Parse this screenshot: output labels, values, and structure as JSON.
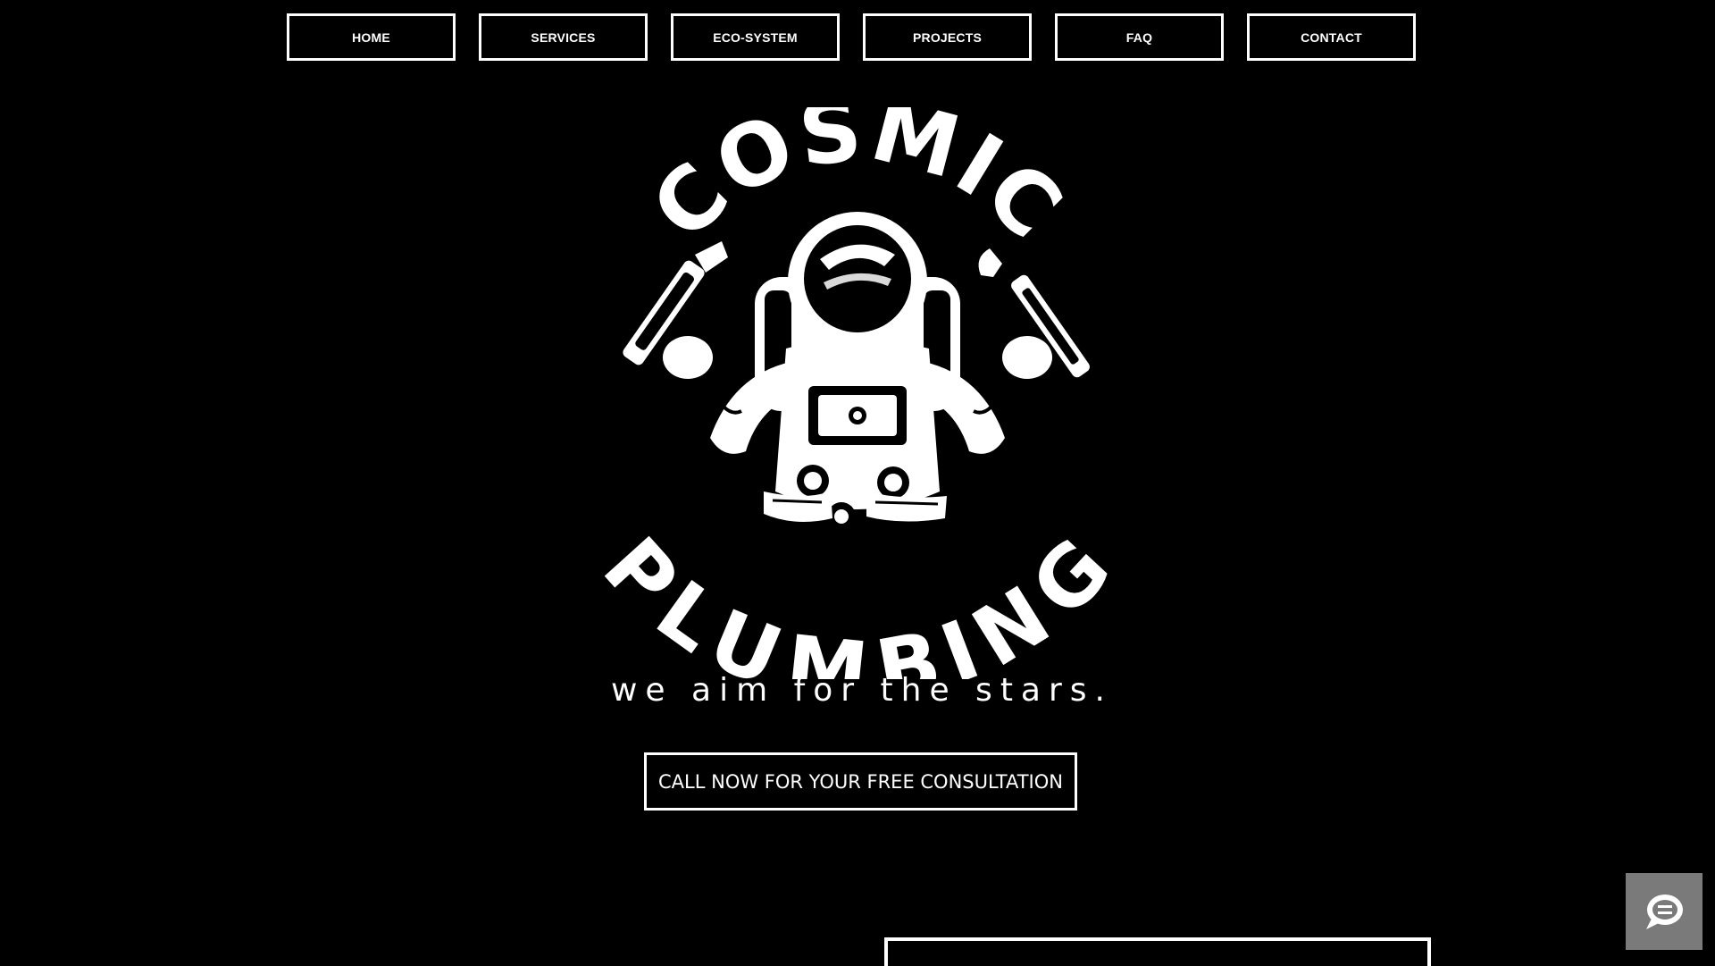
{
  "nav": {
    "items": [
      {
        "label": "HOME"
      },
      {
        "label": "SERVICES"
      },
      {
        "label": "ECO-SYSTEM"
      },
      {
        "label": "PROJECTS"
      },
      {
        "label": "FAQ"
      },
      {
        "label": "CONTACT"
      }
    ]
  },
  "logo": {
    "top_word": "COSMIC",
    "bottom_word": "PLUMBING",
    "icon": "astronaut-plumber-icon"
  },
  "tagline": "we aim for the stars.",
  "cta": {
    "label": "CALL NOW FOR YOUR FREE CONSULTATION"
  },
  "chat_widget": {
    "icon": "chat-bubble-icon"
  },
  "colors": {
    "background": "#000000",
    "foreground": "#ffffff",
    "chat_bg": "#7a7a7a"
  }
}
